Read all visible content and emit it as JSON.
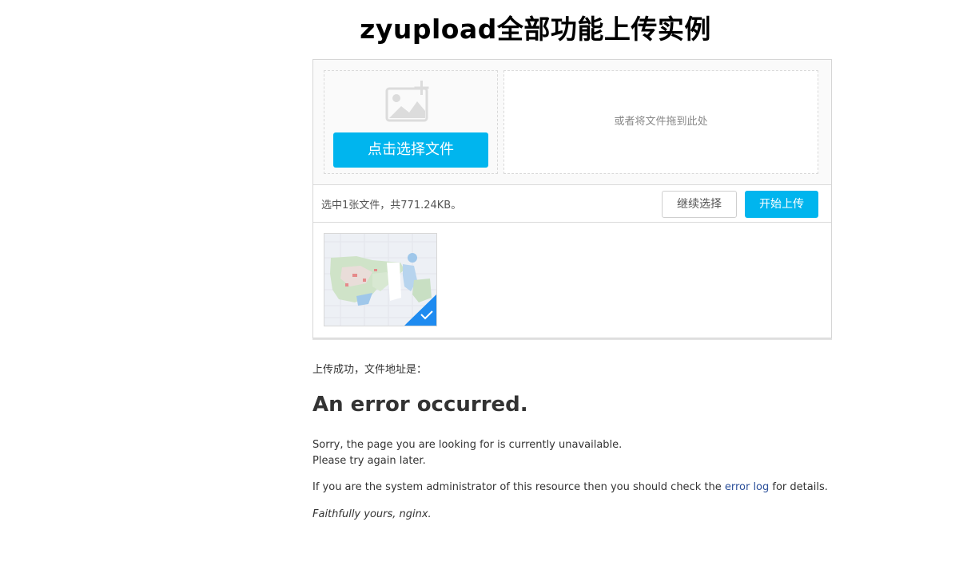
{
  "page": {
    "title": "zyupload全部功能上传实例"
  },
  "uploader": {
    "select_button_label": "点击选择文件",
    "drop_hint": "或者将文件拖到此处",
    "status_text": "选中1张文件，共771.24KB。",
    "continue_button_label": "继续选择",
    "start_button_label": "开始上传",
    "accent_color": "#00b5ee",
    "success_check_color": "#1e8bf0"
  },
  "result": {
    "success_text": "上传成功，文件地址是："
  },
  "error_page": {
    "heading": "An error occurred.",
    "line1": "Sorry, the page you are looking for is currently unavailable.",
    "line2": "Please try again later.",
    "admin_prefix": "If you are the system administrator of this resource then you should check the",
    "error_log_link": "error log",
    "admin_suffix": "for details.",
    "signature": "Faithfully yours, nginx."
  }
}
